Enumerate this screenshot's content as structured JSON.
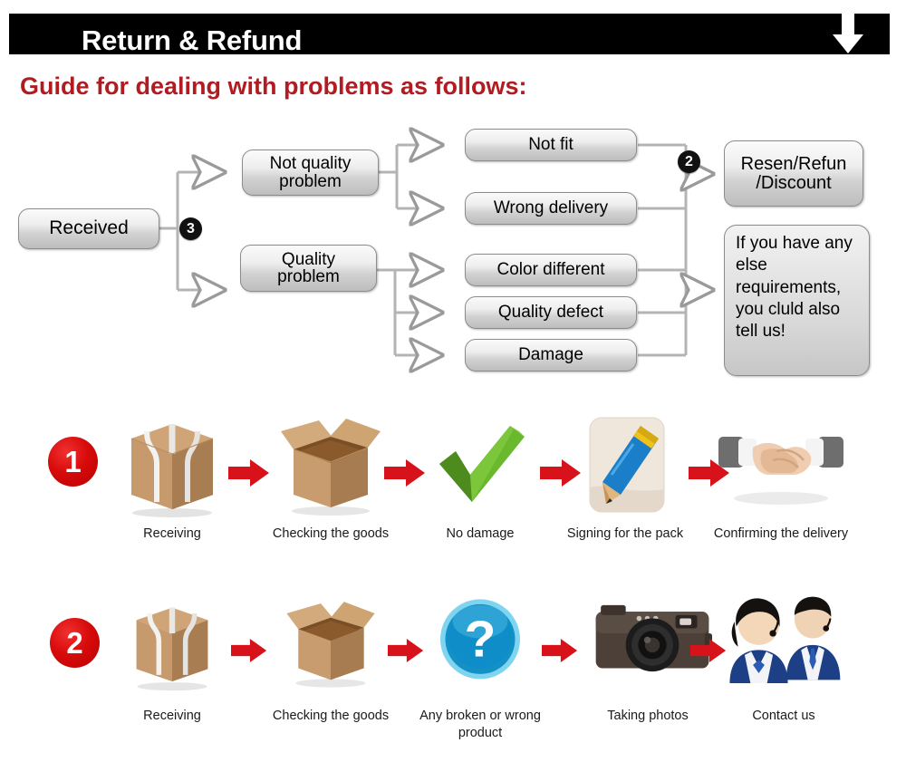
{
  "header": {
    "title": "Return & Refund",
    "arrow_icon": "down-arrow-icon"
  },
  "guide": {
    "title": "Guide for dealing with problems as follows:"
  },
  "flowchart": {
    "start": {
      "label": "Received"
    },
    "badges": {
      "branch": "3",
      "resolution": "2"
    },
    "categories": [
      {
        "label": "Not quality\nproblem"
      },
      {
        "label": "Quality\nproblem"
      }
    ],
    "issues": [
      {
        "label": "Not fit"
      },
      {
        "label": "Wrong delivery"
      },
      {
        "label": "Color different"
      },
      {
        "label": "Quality defect"
      },
      {
        "label": "Damage"
      }
    ],
    "outcomes": [
      {
        "label": "Resen/Refun\n/Discount"
      },
      {
        "label": "If you have any else requirements, you cluld also tell us!"
      }
    ]
  },
  "process": {
    "row1": {
      "badge": "1",
      "steps": [
        {
          "caption": "Receiving",
          "icon": "sealed-box-icon"
        },
        {
          "caption": "Checking the goods",
          "icon": "open-box-icon"
        },
        {
          "caption": "No damage",
          "icon": "green-check-icon"
        },
        {
          "caption": "Signing for the pack",
          "icon": "pencil-signing-icon"
        },
        {
          "caption": "Confirming the delivery",
          "icon": "handshake-icon"
        }
      ]
    },
    "row2": {
      "badge": "2",
      "steps": [
        {
          "caption": "Receiving",
          "icon": "sealed-box-icon"
        },
        {
          "caption": "Checking the goods",
          "icon": "open-box-icon"
        },
        {
          "caption": "Any broken or wrong product",
          "icon": "blue-question-icon"
        },
        {
          "caption": "Taking photos",
          "icon": "camera-icon"
        },
        {
          "caption": "Contact us",
          "icon": "support-people-icon"
        }
      ]
    },
    "arrow_icon": "red-right-arrow-icon"
  },
  "colors": {
    "banner_bg": "#000000",
    "banner_text": "#ffffff",
    "guide_text": "#b01c22",
    "badge_red": "#d80b0b",
    "badge_dark": "#111111",
    "node_border": "#8c8c8c",
    "connector": "#b0b0b0"
  }
}
